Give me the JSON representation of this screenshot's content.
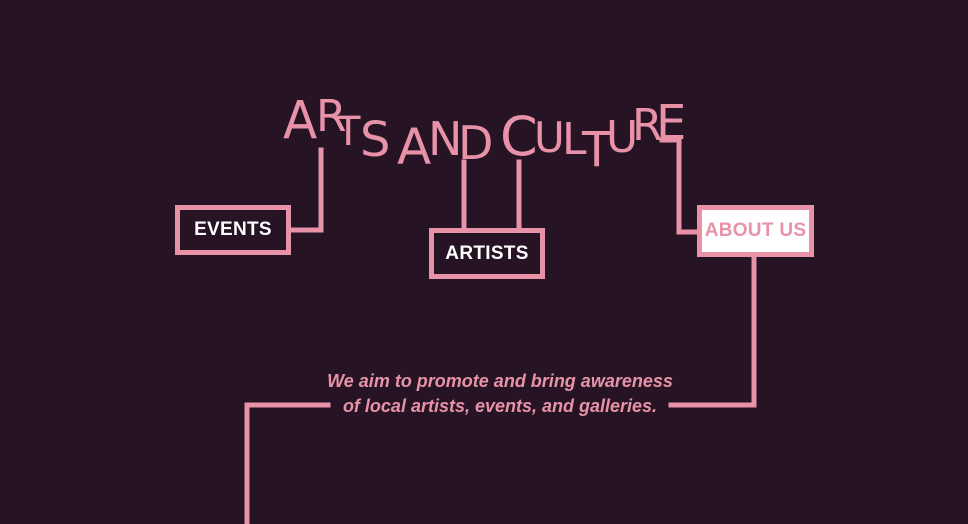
{
  "title": {
    "text": "ARTS AND CULTURE",
    "letters": [
      "A",
      "R",
      "T",
      "S",
      "A",
      "N",
      "D",
      "C",
      "U",
      "L",
      "T",
      "U",
      "R",
      "E"
    ]
  },
  "nav": {
    "events": "EVENTS",
    "artists": "ARTISTS",
    "about": "ABOUT US"
  },
  "tagline": {
    "line1": "We aim to promote and bring awareness",
    "line2": "of local artists, events, and galleries."
  },
  "colors": {
    "background": "#261425",
    "accent": "#e892a8",
    "white": "#ffffff"
  }
}
